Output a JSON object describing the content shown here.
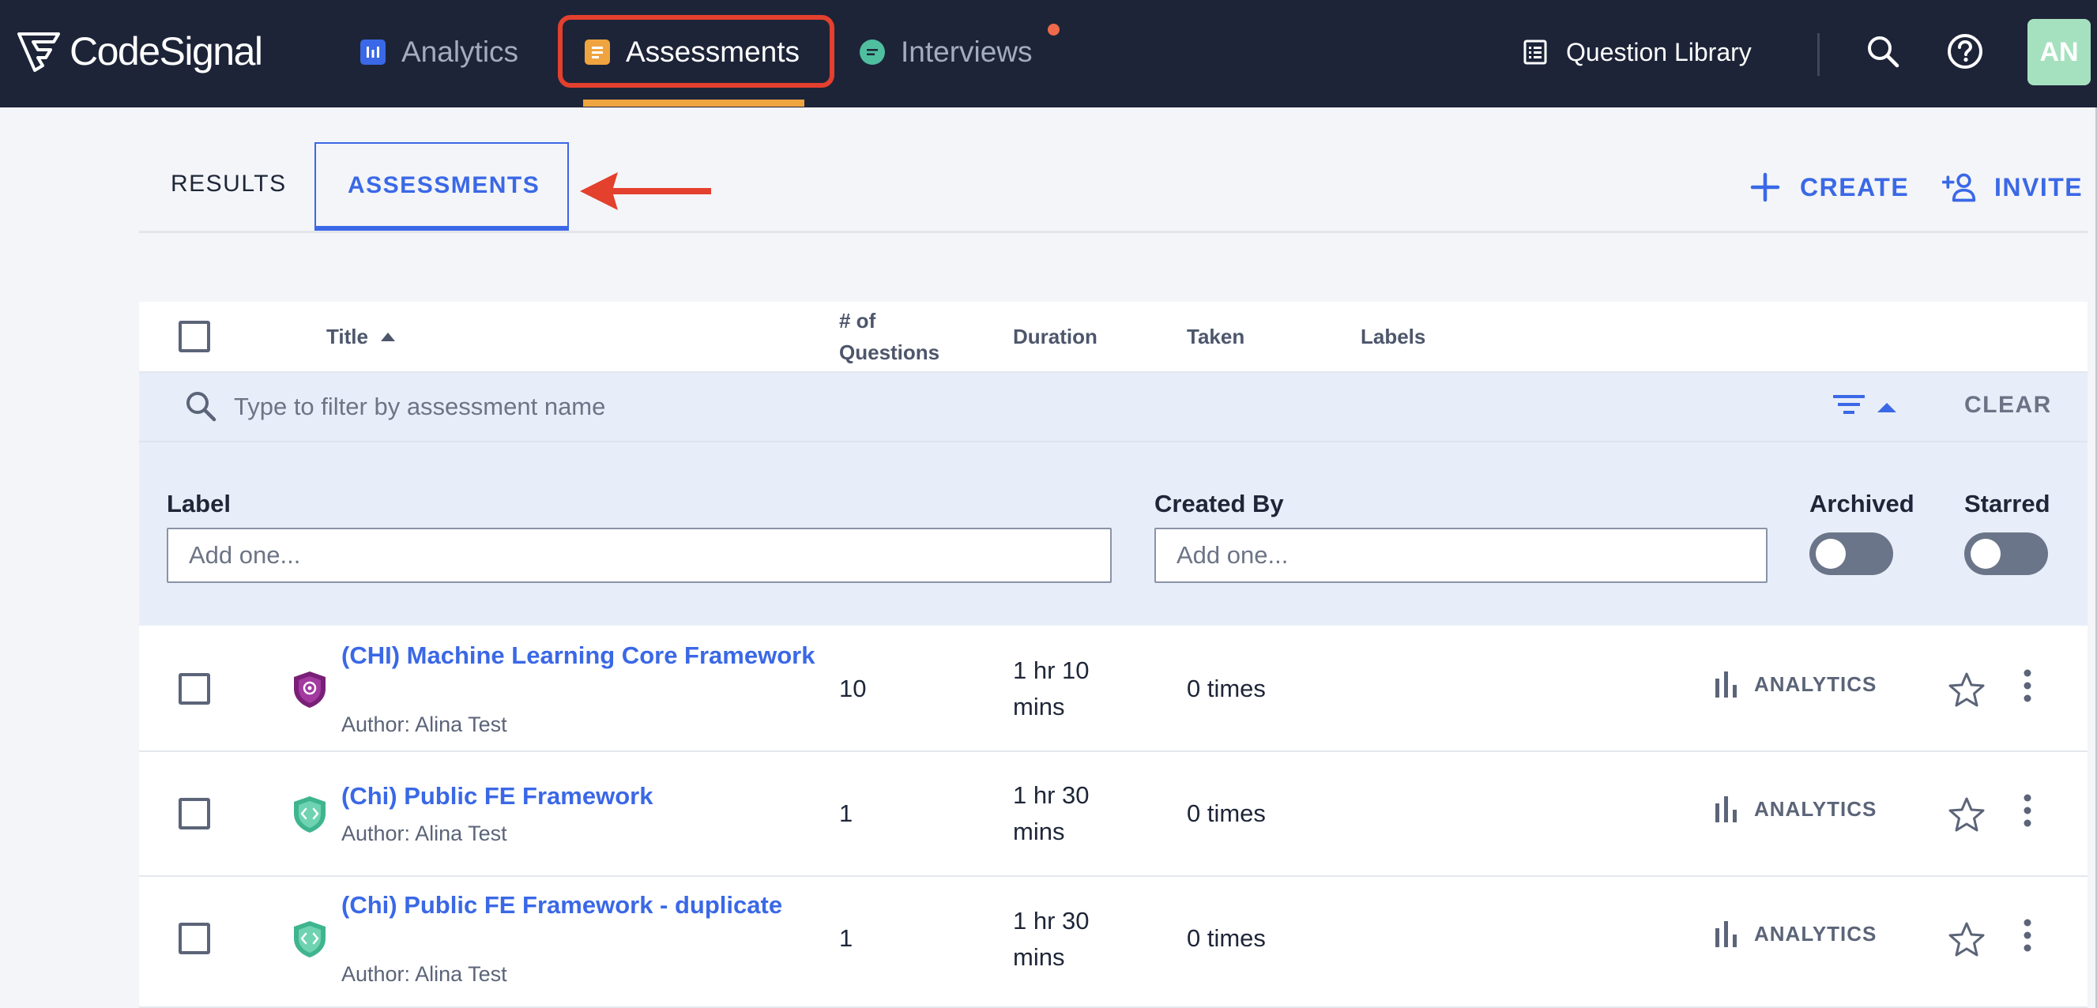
{
  "brand": {
    "name": "CodeSignal"
  },
  "nav": {
    "analytics": "Analytics",
    "assessments": "Assessments",
    "interviews": "Interviews",
    "question_library": "Question Library",
    "avatar_initials": "AN"
  },
  "tabs": {
    "results": "RESULTS",
    "assessments": "ASSESSMENTS"
  },
  "actions": {
    "create": "CREATE",
    "invite": "INVITE"
  },
  "table": {
    "headers": {
      "title": "Title",
      "questions_line1": "# of",
      "questions_line2": "Questions",
      "duration": "Duration",
      "taken": "Taken",
      "labels": "Labels"
    },
    "filter_placeholder": "Type to filter by assessment name",
    "clear": "CLEAR",
    "filters": {
      "label": "Label",
      "label_placeholder": "Add one...",
      "created_by": "Created By",
      "created_by_placeholder": "Add one...",
      "archived": "Archived",
      "starred": "Starred"
    },
    "rows": [
      {
        "title": "(CHI) Machine Learning Core Framework",
        "author": "Author: Alina Test",
        "questions": "10",
        "duration": "1 hr 10 mins",
        "taken": "0 times",
        "analytics": "ANALYTICS",
        "icon": "ml-shield-icon"
      },
      {
        "title": "(Chi) Public FE Framework",
        "author": "Author: Alina Test",
        "questions": "1",
        "duration": "1 hr 30 mins",
        "taken": "0 times",
        "analytics": "ANALYTICS",
        "icon": "code-shield-icon"
      },
      {
        "title": "(Chi) Public FE Framework - duplicate",
        "author": "Author: Alina Test",
        "questions": "1",
        "duration": "1 hr 30 mins",
        "taken": "0 times",
        "analytics": "ANALYTICS",
        "icon": "code-shield-icon"
      }
    ]
  },
  "colors": {
    "nav_bg": "#1d2438",
    "accent_blue": "#3a68e6",
    "highlight_red": "#e3402e",
    "active_underline": "#efa43f",
    "avatar_bg": "#a6e1bf"
  }
}
